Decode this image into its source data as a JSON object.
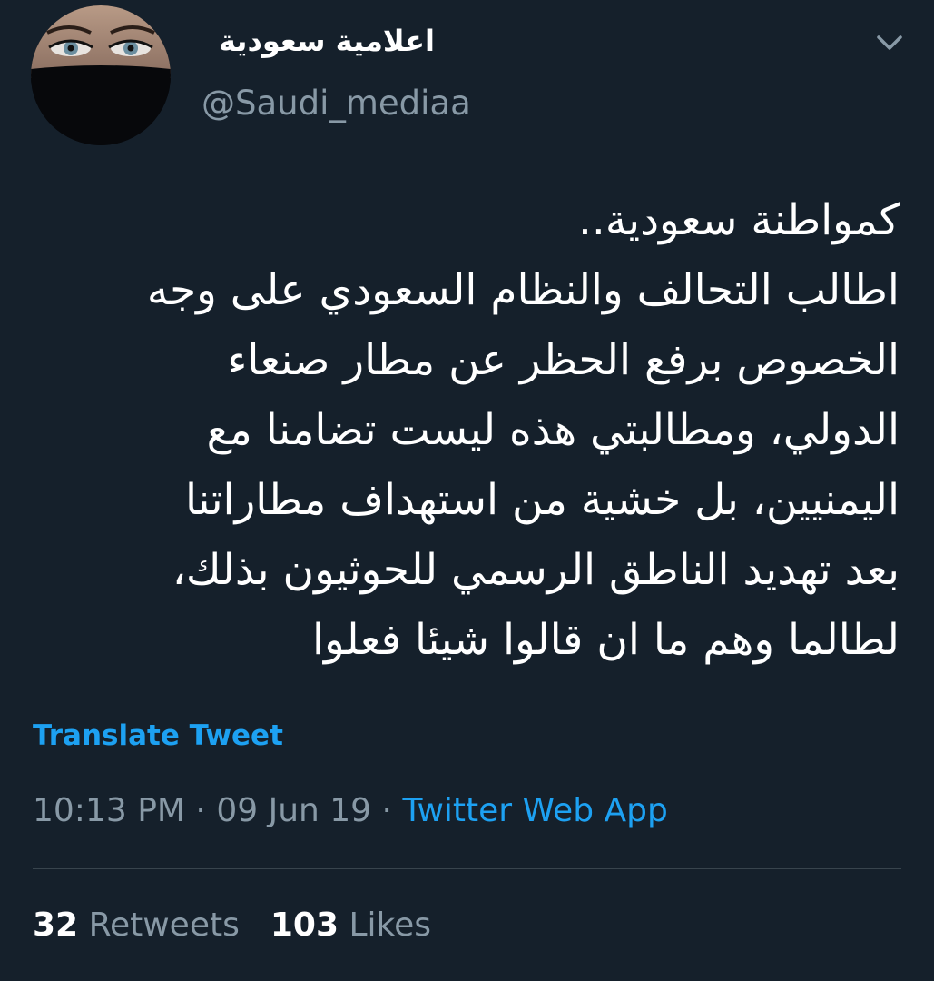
{
  "tweet": {
    "display_name": "اعلامية سعودية",
    "handle": "@Saudi_mediaa",
    "avatar_icon": "profile-avatar-niqab",
    "menu_icon": "chevron-down-icon",
    "text_lines": [
      "كمواطنة سعودية..",
      "اطالب التحالف والنظام السعودي على وجه",
      "الخصوص برفع الحظر عن مطار صنعاء",
      "الدولي، ومطالبتي هذه ليست تضامنا مع",
      "اليمنيين، بل خشية من استهداف مطاراتنا",
      "بعد تهديد الناطق الرسمي للحوثيون بذلك،",
      "لطالما وهم ما ان قالوا شيئا فعلوا"
    ],
    "translate_label": "Translate Tweet",
    "time": "10:13 PM",
    "date": "09 Jun 19",
    "separator": "·",
    "source": "Twitter Web App",
    "retweets_count": "32",
    "retweets_label": "Retweets",
    "likes_count": "103",
    "likes_label": "Likes"
  },
  "colors": {
    "background": "#15202b",
    "accent": "#1da1f2",
    "secondary_text": "#8899a6",
    "divider": "#38444d"
  }
}
